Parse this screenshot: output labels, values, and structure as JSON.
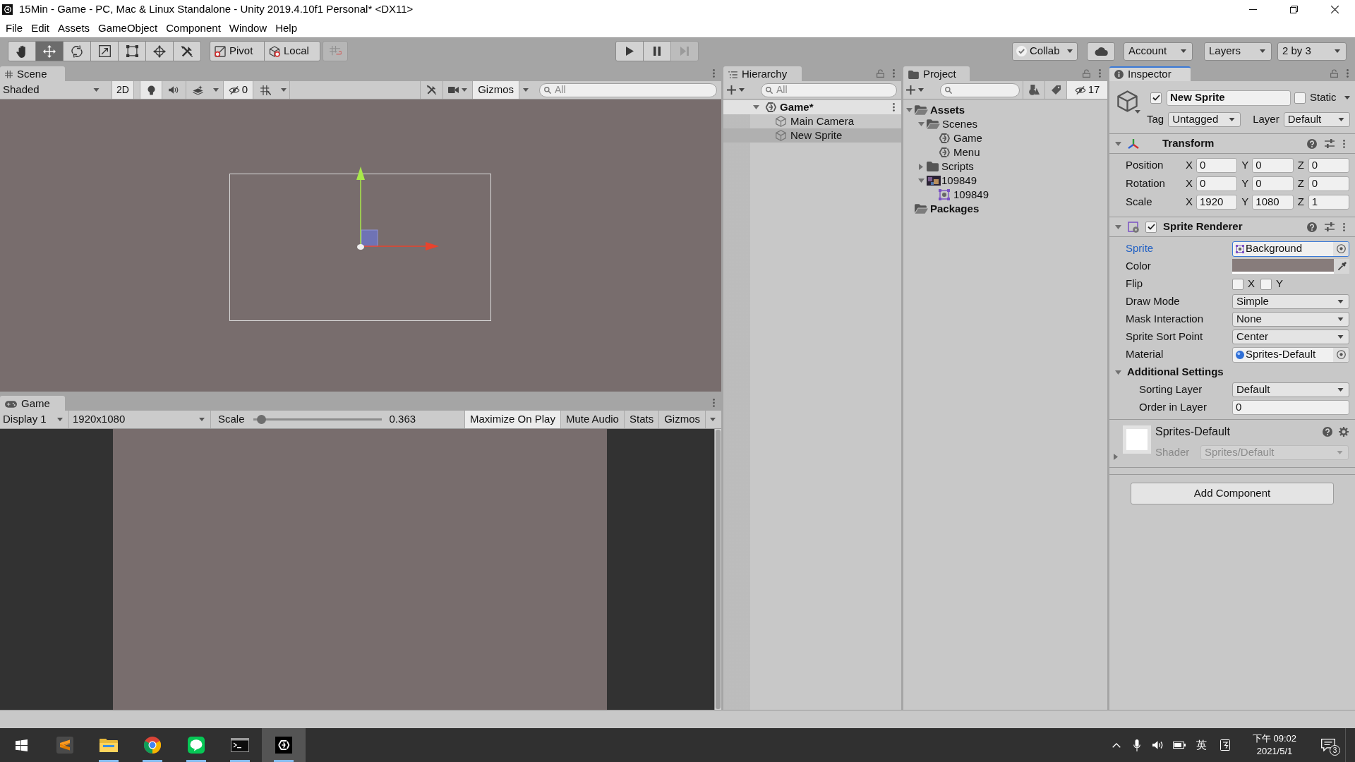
{
  "window": {
    "title": "15Min - Game - PC, Mac & Linux Standalone - Unity 2019.4.10f1 Personal* <DX11>"
  },
  "menu": [
    "File",
    "Edit",
    "Assets",
    "GameObject",
    "Component",
    "Window",
    "Help"
  ],
  "toolbar": {
    "tools": [
      {
        "kind": "hand",
        "selected": false
      },
      {
        "kind": "move",
        "selected": true
      },
      {
        "kind": "rotate",
        "selected": false
      },
      {
        "kind": "scale",
        "selected": false
      },
      {
        "kind": "rect",
        "selected": false
      },
      {
        "kind": "transform",
        "selected": false
      },
      {
        "kind": "custom",
        "selected": false
      }
    ],
    "handle_toggles": [
      {
        "kind": "pivot",
        "label": "Pivot"
      },
      {
        "kind": "local",
        "label": "Local"
      }
    ],
    "snap": {
      "disabled": true
    },
    "playback": [
      {
        "kind": "play",
        "disabled": false
      },
      {
        "kind": "pause",
        "disabled": false
      },
      {
        "kind": "step",
        "disabled": true
      }
    ],
    "collab": {
      "label": "Collab"
    },
    "account": {
      "label": "Account"
    },
    "layers": {
      "label": "Layers"
    },
    "layout": {
      "label": "2 by 3"
    }
  },
  "scene": {
    "tab": {
      "label": "Scene",
      "focused": false
    },
    "shading": "Shaded",
    "toggles": [
      {
        "kind": "mode",
        "label": "2D",
        "on": true
      },
      {
        "kind": "lighting",
        "on": true
      },
      {
        "kind": "audio",
        "on": false
      },
      {
        "kind": "effects",
        "on": false
      }
    ],
    "hidden_objects": {
      "count": "0",
      "on": true
    },
    "grid": {
      "on": false
    },
    "gizmos": {
      "label": "Gizmos",
      "on": true
    },
    "search": {
      "placeholder": "All"
    }
  },
  "game": {
    "tab": {
      "label": "Game",
      "focused": false
    },
    "display": "Display 1",
    "resolution": "1920x1080",
    "scale": {
      "label": "Scale",
      "level": 0.03,
      "reading": "0.363"
    },
    "toggles": [
      {
        "label": "Maximize On Play",
        "on": true
      },
      {
        "label": "Mute Audio",
        "on": false
      },
      {
        "label": "Stats",
        "on": false
      },
      {
        "label": "Gizmos",
        "on": false
      }
    ]
  },
  "hierarchy": {
    "tab": {
      "label": "Hierarchy",
      "focused": false
    },
    "search": {
      "placeholder": "All"
    },
    "scene": {
      "label": "Game*",
      "expanded": true,
      "children": [
        {
          "label": "Main Camera",
          "selected": false
        },
        {
          "label": "New Sprite",
          "selected": true
        }
      ]
    }
  },
  "project": {
    "tab": {
      "label": "Project",
      "focused": false
    },
    "hidden_count": {
      "count": "17",
      "on": true
    },
    "tree": [
      {
        "kind": "folder",
        "label": "Assets",
        "expanded": true,
        "children": [
          {
            "kind": "folder",
            "label": "Scenes",
            "expanded": true,
            "children": [
              {
                "kind": "scene",
                "label": "Game"
              },
              {
                "kind": "scene",
                "label": "Menu"
              }
            ]
          },
          {
            "kind": "folder",
            "label": "Scripts",
            "expanded": false
          },
          {
            "kind": "texture",
            "label": "109849",
            "expanded": true,
            "children": [
              {
                "kind": "sprite",
                "label": "109849"
              }
            ]
          }
        ]
      },
      {
        "kind": "folder",
        "label": "Packages"
      }
    ]
  },
  "inspector": {
    "tab": {
      "label": "Inspector",
      "focused": true
    },
    "object": {
      "active": true,
      "name": "New Sprite",
      "static": {
        "label": "Static",
        "checked": false
      },
      "tag": {
        "label": "Tag",
        "value": "Untagged"
      },
      "layer": {
        "label": "Layer",
        "value": "Default"
      }
    },
    "components": [
      {
        "kind": "transform",
        "title": "Transform",
        "expanded": true,
        "rows": [
          {
            "label": "Position",
            "fields": [
              {
                "axis": "X",
                "value": "0"
              },
              {
                "axis": "Y",
                "value": "0"
              },
              {
                "axis": "Z",
                "value": "0"
              }
            ]
          },
          {
            "label": "Rotation",
            "fields": [
              {
                "axis": "X",
                "value": "0"
              },
              {
                "axis": "Y",
                "value": "0"
              },
              {
                "axis": "Z",
                "value": "0"
              }
            ]
          },
          {
            "label": "Scale",
            "fields": [
              {
                "axis": "X",
                "value": "1920"
              },
              {
                "axis": "Y",
                "value": "1080"
              },
              {
                "axis": "Z",
                "value": "1"
              }
            ]
          }
        ]
      },
      {
        "kind": "sprite_renderer",
        "title": "Sprite Renderer",
        "enabled": true,
        "expanded": true,
        "properties": [
          {
            "kind": "sprite",
            "label": "Sprite",
            "value": "Background",
            "focused": true
          },
          {
            "kind": "color",
            "label": "Color",
            "color": "#877c7b",
            "focused": false
          },
          {
            "kind": "flip",
            "label": "Flip",
            "toggles": [
              {
                "label": "X",
                "checked": false
              },
              {
                "label": "Y",
                "checked": false
              }
            ],
            "focused": false
          },
          {
            "kind": "dropdown",
            "label": "Draw Mode",
            "value": "Simple",
            "focused": false
          },
          {
            "kind": "dropdown",
            "label": "Mask Interaction",
            "value": "None",
            "focused": false
          },
          {
            "kind": "dropdown",
            "label": "Sprite Sort Point",
            "value": "Center",
            "focused": false
          },
          {
            "kind": "material",
            "label": "Material",
            "value": "Sprites-Default",
            "focused": false
          },
          {
            "kind": "foldout",
            "label": "Additional Settings",
            "expanded": true,
            "children": [
              {
                "kind": "dropdown",
                "label": "Sorting Layer",
                "value": "Default",
                "focused": false
              },
              {
                "kind": "number",
                "label": "Order in Layer",
                "value": "0",
                "focused": false
              }
            ]
          }
        ]
      },
      {
        "kind": "material",
        "title": "Sprites-Default",
        "expanded": false,
        "shader": {
          "label": "Shader",
          "value": "Sprites/Default",
          "disabled": true
        }
      }
    ],
    "add_component": "Add Component"
  },
  "taskbar": {
    "apps": [
      {
        "kind": "sublime",
        "running": false,
        "active": false
      },
      {
        "kind": "explorer",
        "running": true,
        "active": false
      },
      {
        "kind": "chrome",
        "running": true,
        "active": false
      },
      {
        "kind": "line",
        "running": true,
        "active": false
      },
      {
        "kind": "terminal",
        "running": true,
        "active": false
      },
      {
        "kind": "unity",
        "running": true,
        "active": true
      }
    ],
    "tray": {
      "input_mode": "英",
      "time": "下午 09:02",
      "date": "2021/5/1",
      "notifications": "3"
    }
  }
}
